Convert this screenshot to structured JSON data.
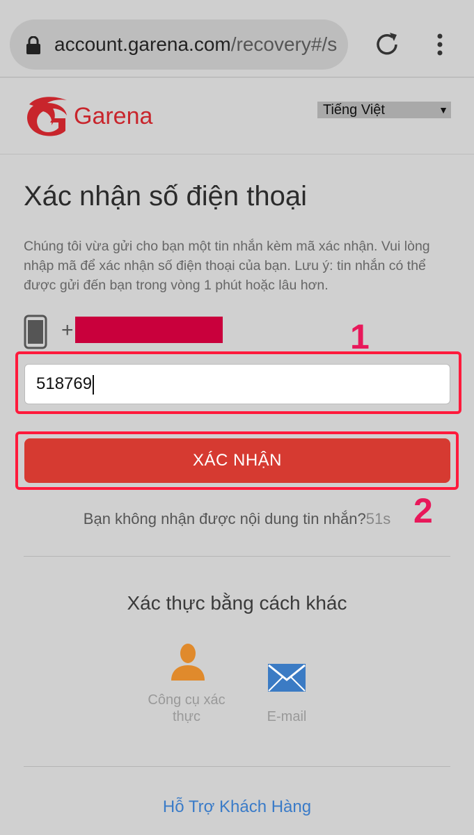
{
  "browser": {
    "url_domain": "account.garena.com",
    "url_path": "/recovery#/s"
  },
  "header": {
    "logo_text": "Garena",
    "language": "Tiếng Việt"
  },
  "main": {
    "title": "Xác nhận số điện thoại",
    "description": "Chúng tôi vừa gửi cho bạn một tin nhắn kèm mã xác nhận. Vui lòng nhập mã để xác nhận số điện thoại của bạn. Lưu ý: tin nhắn có thể được gửi đến bạn trong vòng 1 phút hoặc lâu hơn.",
    "phone_prefix": "+",
    "code_value": "518769",
    "confirm_label": "XÁC NHẬN",
    "resend_text": "Bạn không nhận được nội dung tin nhắn?",
    "resend_countdown": "51s"
  },
  "annotations": {
    "step1": "1",
    "step2": "2",
    "color": "#e8185a"
  },
  "alternative": {
    "title": "Xác thực bằng cách khác",
    "tool_label": "Công cụ xác thực",
    "email_label": "E-mail"
  },
  "footer": {
    "support_label": "Hỗ Trợ Khách Hàng"
  },
  "colors": {
    "brand": "#c8252c",
    "button": "#d63a31",
    "link": "#3a7bc8",
    "highlight": "#ff1a3c"
  }
}
